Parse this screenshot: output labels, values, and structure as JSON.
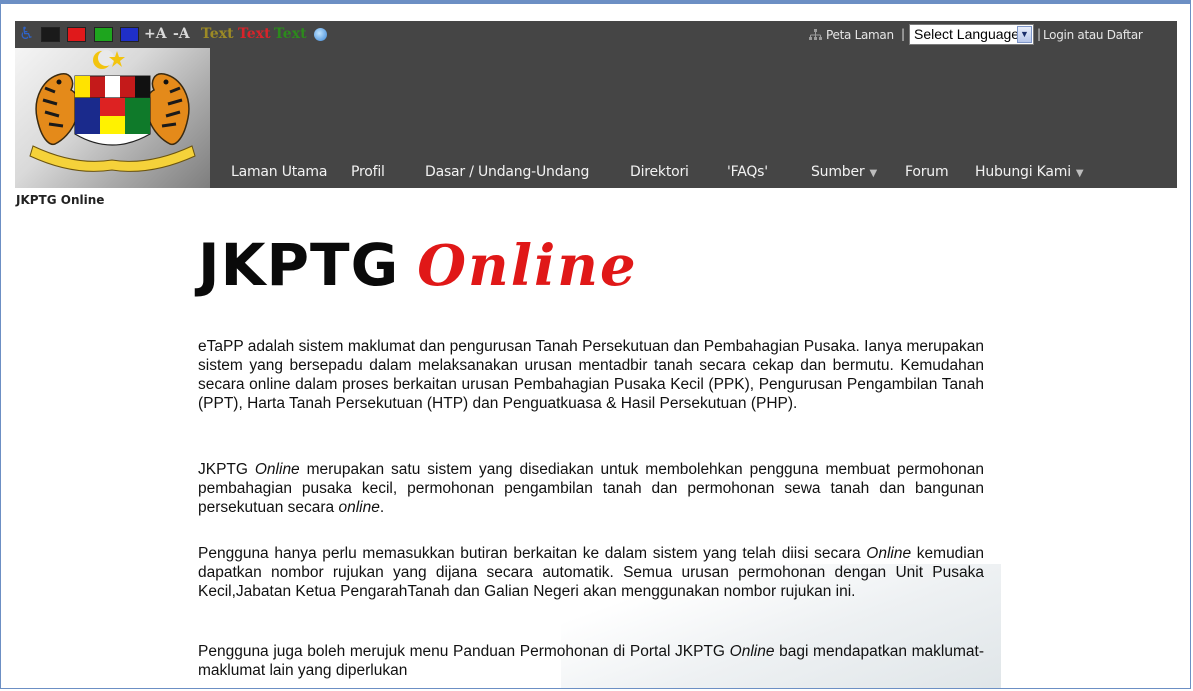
{
  "toolbar": {
    "text_size": {
      "increase": "+A",
      "decrease": "-A"
    },
    "text_colors": [
      "Text",
      "Text",
      "Text"
    ],
    "sitemap_label": "Peta Laman",
    "separator": "|",
    "language_select_value": "Select Language",
    "login_label": "Login atau Daftar"
  },
  "nav": {
    "items": [
      {
        "label": "Laman Utama",
        "has_dropdown": false
      },
      {
        "label": "Profil",
        "has_dropdown": false
      },
      {
        "label": "Dasar / Undang-Undang",
        "has_dropdown": false
      },
      {
        "label": "Direktori",
        "has_dropdown": false
      },
      {
        "label": "'FAQs'",
        "has_dropdown": false
      },
      {
        "label": "Sumber",
        "has_dropdown": true
      },
      {
        "label": "Forum",
        "has_dropdown": false
      },
      {
        "label": "Hubungi Kami",
        "has_dropdown": true
      }
    ]
  },
  "breadcrumb": "JKPTG Online",
  "banner": {
    "main": "JKPTG",
    "accent": "Online"
  },
  "paragraphs": {
    "p1": "eTaPP adalah sistem maklumat dan pengurusan Tanah Persekutuan dan Pembahagian Pusaka. Ianya merupakan sistem yang bersepadu dalam melaksanakan urusan mentadbir tanah secara cekap dan bermutu. Kemudahan secara online dalam proses berkaitan urusan Pembahagian Pusaka Kecil (PPK), Pengurusan Pengambilan Tanah (PPT), Harta Tanah Persekutuan (HTP) dan Penguatkuasa & Hasil Persekutuan (PHP).",
    "p2_a": "JKPTG ",
    "p2_b": "Online",
    "p2_c": " merupakan satu sistem yang disediakan untuk membolehkan pengguna membuat permohonan pembahagian pusaka kecil, permohonan pengambilan tanah dan permohonan sewa tanah dan bangunan persekutuan secara ",
    "p2_d": "online",
    "p2_e": ".",
    "p3_a": "Pengguna hanya perlu memasukkan butiran berkaitan ke dalam sistem yang telah diisi secara ",
    "p3_b": "Online",
    "p3_c": " kemudian dapatkan nombor rujukan yang dijana secara automatik. Semua urusan permohonan dengan Unit Pusaka Kecil,Jabatan Ketua PengarahTanah dan Galian Negeri akan menggunakan nombor rujukan ini.",
    "p4_a": "Pengguna juga boleh merujuk menu Panduan Permohonan di Portal JKPTG ",
    "p4_b": "Online",
    "p4_c": " bagi mendapatkan maklumat-maklumat lain yang diperlukan"
  },
  "colors": {
    "header_bg": "#454545",
    "swatches": [
      "#1a1a1a",
      "#e0191b",
      "#1ea51e",
      "#1f2fc8"
    ],
    "accent_red": "#e01818"
  },
  "icons": [
    "accessibility-icon",
    "reset-icon",
    "sitemap-icon",
    "coat-of-arms-logo"
  ]
}
